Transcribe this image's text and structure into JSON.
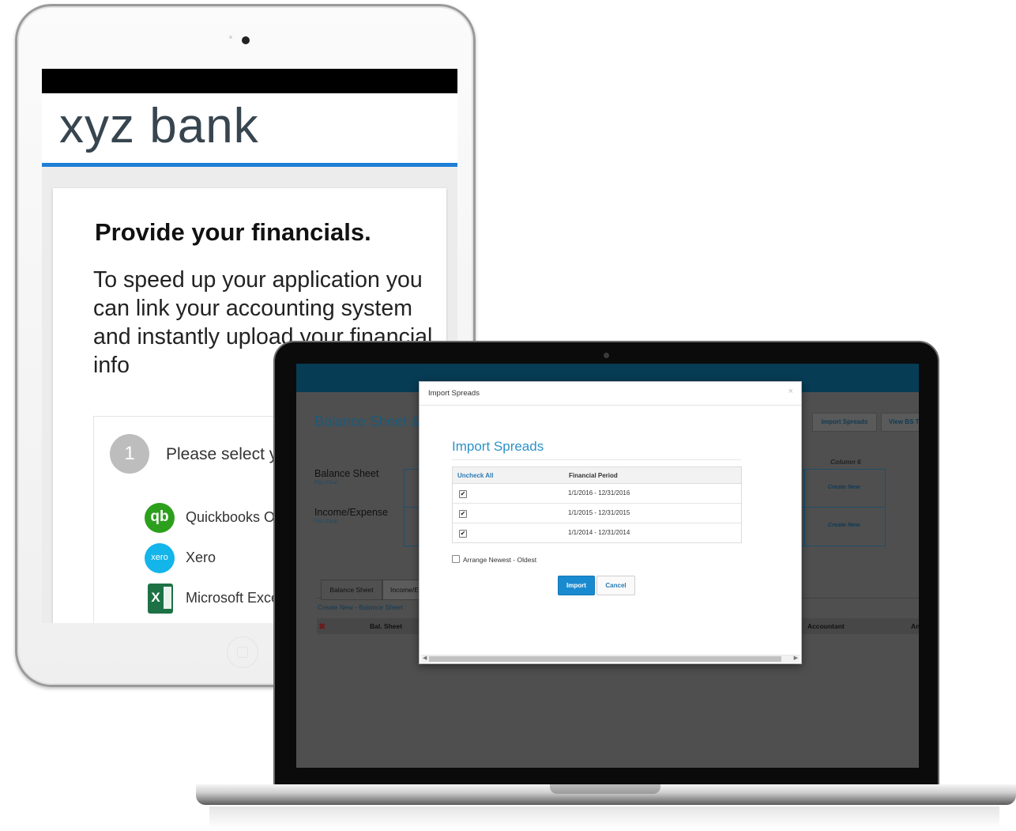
{
  "tablet": {
    "logo": "xyz bank",
    "heading": "Provide your financials.",
    "body": "To speed up your application you can link your accounting system and instantly upload your financial info",
    "step_number": "1",
    "step_text": "Please select your accounting system",
    "providers": [
      {
        "label": "Quickbooks Online",
        "icon": "quickbooks-icon",
        "glyph": "qb"
      },
      {
        "label": "Xero",
        "icon": "xero-icon",
        "glyph": "xero"
      },
      {
        "label": "Microsoft Excel",
        "icon": "excel-icon",
        "glyph": "X"
      }
    ]
  },
  "app": {
    "page_title": "Balance Sheet & Income/Expense",
    "buttons": {
      "import_spreads": "Import Spreads",
      "view_bs": "View BS Template"
    },
    "column_label": "Column 6",
    "sections": [
      {
        "name": "Balance Sheet",
        "links": "Flip | Clear",
        "create_new": "Create New"
      },
      {
        "name": "Income/Expense",
        "links": "Flip | Clear",
        "create_new": "Create New"
      }
    ],
    "tabs": [
      "Balance Sheet",
      "Income/Expense"
    ],
    "create_link": "Create New - Balance Sheet",
    "table_headers": {
      "bal_sheet": "Bal. Sheet",
      "accountant": "Accountant",
      "an": "An"
    }
  },
  "modal": {
    "title": "Import Spreads",
    "close": "×",
    "heading": "Import Spreads",
    "uncheck_all": "Uncheck All",
    "period_header": "Financial Period",
    "rows": [
      {
        "checked": true,
        "period": "1/1/2016 - 12/31/2016"
      },
      {
        "checked": true,
        "period": "1/1/2015 - 12/31/2015"
      },
      {
        "checked": true,
        "period": "1/1/2014 - 12/31/2014"
      }
    ],
    "arrange_label": "Arrange Newest - Oldest",
    "arrange_checked": false,
    "import_label": "Import",
    "cancel_label": "Cancel",
    "check_mark": "✔"
  },
  "colors": {
    "accent_blue": "#2c92c8",
    "import_button": "#1a8ad0",
    "bank_line": "#1d7fd6"
  }
}
